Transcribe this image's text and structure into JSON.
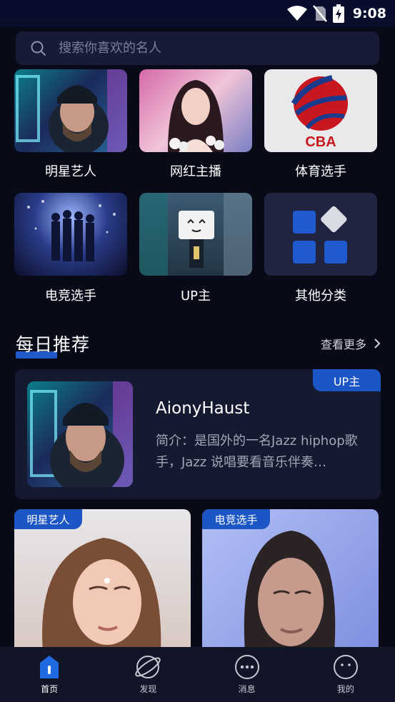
{
  "status": {
    "time": "9:08"
  },
  "search": {
    "placeholder": "搜索你喜欢的名人"
  },
  "categories": [
    {
      "label": "明星艺人"
    },
    {
      "label": "网红主播"
    },
    {
      "label": "体育选手",
      "logo_text": "CBA"
    },
    {
      "label": "电竞选手"
    },
    {
      "label": "UP主"
    },
    {
      "label": "其他分类"
    }
  ],
  "section": {
    "title": "每日推荐",
    "more": "查看更多"
  },
  "recommend": {
    "badge": "UP主",
    "name": "AionyHaust",
    "description": "简介：是国外的一名Jazz hiphop歌手，Jazz 说唱要看音乐伴奏…"
  },
  "photo_cards": [
    {
      "badge": "明星艺人"
    },
    {
      "badge": "电竞选手"
    }
  ],
  "tabs": [
    {
      "label": "首页",
      "icon": "home-icon",
      "active": true
    },
    {
      "label": "发现",
      "icon": "planet-icon",
      "active": false
    },
    {
      "label": "消息",
      "icon": "message-icon",
      "active": false
    },
    {
      "label": "我的",
      "icon": "profile-icon",
      "active": false
    }
  ],
  "colors": {
    "accent": "#1b56c4",
    "background": "#080a18",
    "card": "#151a30"
  }
}
